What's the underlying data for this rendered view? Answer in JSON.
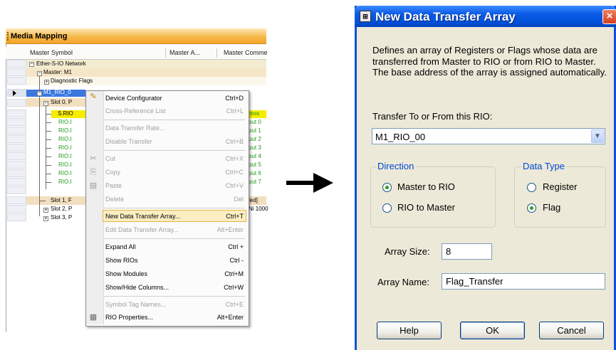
{
  "media_mapping": {
    "title": "Media Mapping",
    "columns": [
      "Master Symbol",
      "Master A...",
      "Master Comme"
    ],
    "rows": [
      {
        "label": "Ether-S-IO Network",
        "color": "#000000"
      },
      {
        "label": "Master: M1",
        "color": "#000000"
      },
      {
        "label": "Diagnostic Flags",
        "color": "#000000"
      },
      {
        "label": "M1_RIO_0",
        "color": "#ffffff"
      },
      {
        "label": "Slot 0, P",
        "color": "#000000"
      },
      {
        "label": "S.RIO",
        "color": "#000000"
      },
      {
        "label": "RIO.I",
        "color": "#1a9a1a"
      },
      {
        "label": "RIO.I",
        "color": "#1a9a1a"
      },
      {
        "label": "RIO.I",
        "color": "#1a9a1a"
      },
      {
        "label": "RIO.I",
        "color": "#1a9a1a"
      },
      {
        "label": "RIO.I",
        "color": "#1a9a1a"
      },
      {
        "label": "RIO.I",
        "color": "#1a9a1a"
      },
      {
        "label": "RIO.I",
        "color": "#1a9a1a"
      },
      {
        "label": "RIO.I",
        "color": "#1a9a1a"
      },
      {
        "label": "Slot 1, F",
        "color": "#000000"
      },
      {
        "label": "Slot 2, P",
        "color": "#000000"
      },
      {
        "label": "Slot 3, P",
        "color": "#000000"
      }
    ],
    "comments": [
      "ress",
      "put 0",
      "put 1",
      "put 2",
      "put 3",
      "put 4",
      "put 5",
      "put 6",
      "put 7",
      "led]",
      "Ni 1000"
    ]
  },
  "context_menu": {
    "items": [
      {
        "label": "Device Configurator",
        "shortcut": "Ctrl+D",
        "enabled": true
      },
      {
        "label": "Cross-Reference List",
        "shortcut": "Ctrl+L",
        "enabled": false
      },
      {
        "label": "Data Transfer Rate...",
        "shortcut": "",
        "enabled": false
      },
      {
        "label": "Disable Transfer",
        "shortcut": "Ctrl+B",
        "enabled": false
      },
      {
        "label": "Cut",
        "shortcut": "Ctrl+X",
        "enabled": false
      },
      {
        "label": "Copy",
        "shortcut": "Ctrl+C",
        "enabled": false
      },
      {
        "label": "Paste",
        "shortcut": "Ctrl+V",
        "enabled": false
      },
      {
        "label": "Delete",
        "shortcut": "Del",
        "enabled": false
      },
      {
        "label": "New Data Transfer Array...",
        "shortcut": "Ctrl+T",
        "enabled": true,
        "highlighted": true
      },
      {
        "label": "Edit Data Transfer Array...",
        "shortcut": "Alt+Enter",
        "enabled": false
      },
      {
        "label": "Expand All",
        "shortcut": "Ctrl +",
        "enabled": true
      },
      {
        "label": "Show RIOs",
        "shortcut": "Ctrl -",
        "enabled": true
      },
      {
        "label": "Show Modules",
        "shortcut": "Ctrl+M",
        "enabled": true
      },
      {
        "label": "Show/Hide Columns...",
        "shortcut": "Ctrl+W",
        "enabled": true
      },
      {
        "label": "Symbol Tag Names...",
        "shortcut": "Ctrl+E",
        "enabled": false
      },
      {
        "label": "RIO Properties...",
        "shortcut": "Alt+Enter",
        "enabled": true
      }
    ]
  },
  "dialog": {
    "title": "New Data Transfer Array",
    "description": "Defines an array of Registers or Flags whose data are transferred from Master to RIO or from RIO to Master. The base address of the array is assigned automatically.",
    "transfer_label": "Transfer To or From this RIO:",
    "transfer_value": "M1_RIO_00",
    "direction_title": "Direction",
    "direction_options": [
      "Master to RIO",
      "RIO to Master"
    ],
    "direction_selected": "Master to RIO",
    "datatype_title": "Data Type",
    "datatype_options": [
      "Register",
      "Flag"
    ],
    "datatype_selected": "Flag",
    "array_size_label": "Array Size:",
    "array_size_value": "8",
    "array_name_label": "Array Name:",
    "array_name_value": "Flag_Transfer",
    "buttons": {
      "help": "Help",
      "ok": "OK",
      "cancel": "Cancel"
    }
  },
  "colors": {
    "titlebar_blue": "#0a52dd",
    "media_header_orange": "#f7b94a",
    "menu_highlight": "#fdeec2",
    "selected_row": "#3a78e0",
    "yellow_row": "#f5ec00"
  }
}
